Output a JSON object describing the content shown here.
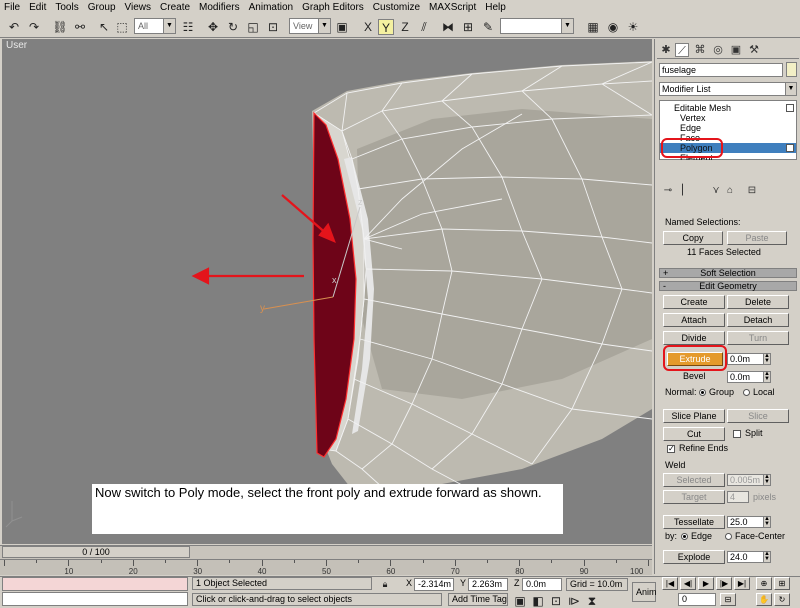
{
  "menu": [
    "File",
    "Edit",
    "Tools",
    "Group",
    "Views",
    "Create",
    "Modifiers",
    "Animation",
    "Graph Editors",
    "Customize",
    "MAXScript",
    "Help"
  ],
  "toolbar": {
    "selection_filter": "All",
    "reference_coord": "View"
  },
  "viewport": {
    "label": "User",
    "note": "Now switch to Poly mode, select the front poly and extrude forward as shown.",
    "axis_y": "y",
    "axis_z": "z",
    "axis_x": "x",
    "colors": {
      "selected_poly": "#6e0418",
      "mesh": "#bdbab0",
      "background": "#808080",
      "arrow": "#e4141b"
    }
  },
  "command_panel": {
    "object_name": "fuselage",
    "modifier_list": "Modifier List",
    "stack": {
      "base": "Editable Mesh",
      "sub": [
        "Vertex",
        "Edge",
        "Face",
        "Polygon",
        "Element"
      ],
      "selected": "Polygon"
    },
    "named_selections": {
      "title": "Named Selections:",
      "copy": "Copy",
      "paste": "Paste",
      "status": "11 Faces Selected"
    },
    "rollouts": {
      "soft_selection": "Soft Selection",
      "edit_geometry": "Edit Geometry",
      "soft_pm": "+",
      "edit_pm": "-"
    },
    "edit_geometry": {
      "create": "Create",
      "delete": "Delete",
      "attach": "Attach",
      "detach": "Detach",
      "divide": "Divide",
      "turn": "Turn",
      "extrude": "Extrude",
      "extrude_value": "0.0m",
      "bevel": "Bevel",
      "bevel_value": "0.0m",
      "normal_label": "Normal:",
      "group": "Group",
      "local": "Local",
      "slice_plane": "Slice Plane",
      "slice": "Slice",
      "cut": "Cut",
      "split": "Split",
      "refine_ends": "Refine Ends",
      "weld_title": "Weld",
      "selected": "Selected",
      "selected_value": "0.005m",
      "target": "Target",
      "target_value": "4",
      "pixels": "pixels",
      "tessellate": "Tessellate",
      "tessellate_value": "25.0",
      "by_label": "by:",
      "edge": "Edge",
      "face_center": "Face-Center",
      "explode": "Explode",
      "explode_value": "24.0"
    }
  },
  "timeline": {
    "slider": "0 / 100",
    "ticks": [
      "10",
      "20",
      "30",
      "40",
      "50",
      "60",
      "70",
      "80",
      "90",
      "100"
    ]
  },
  "status": {
    "selection": "1 Object Selected",
    "prompt": "Click or click-and-drag to select objects",
    "x_label": "X",
    "x_value": "-2.314m",
    "y_label": "Y",
    "y_value": "2.263m",
    "z_label": "Z",
    "z_value": "0.0m",
    "grid": "Grid = 10.0m",
    "add_time_tag": "Add Time Tag",
    "anim": "Anim",
    "frame": "0"
  }
}
